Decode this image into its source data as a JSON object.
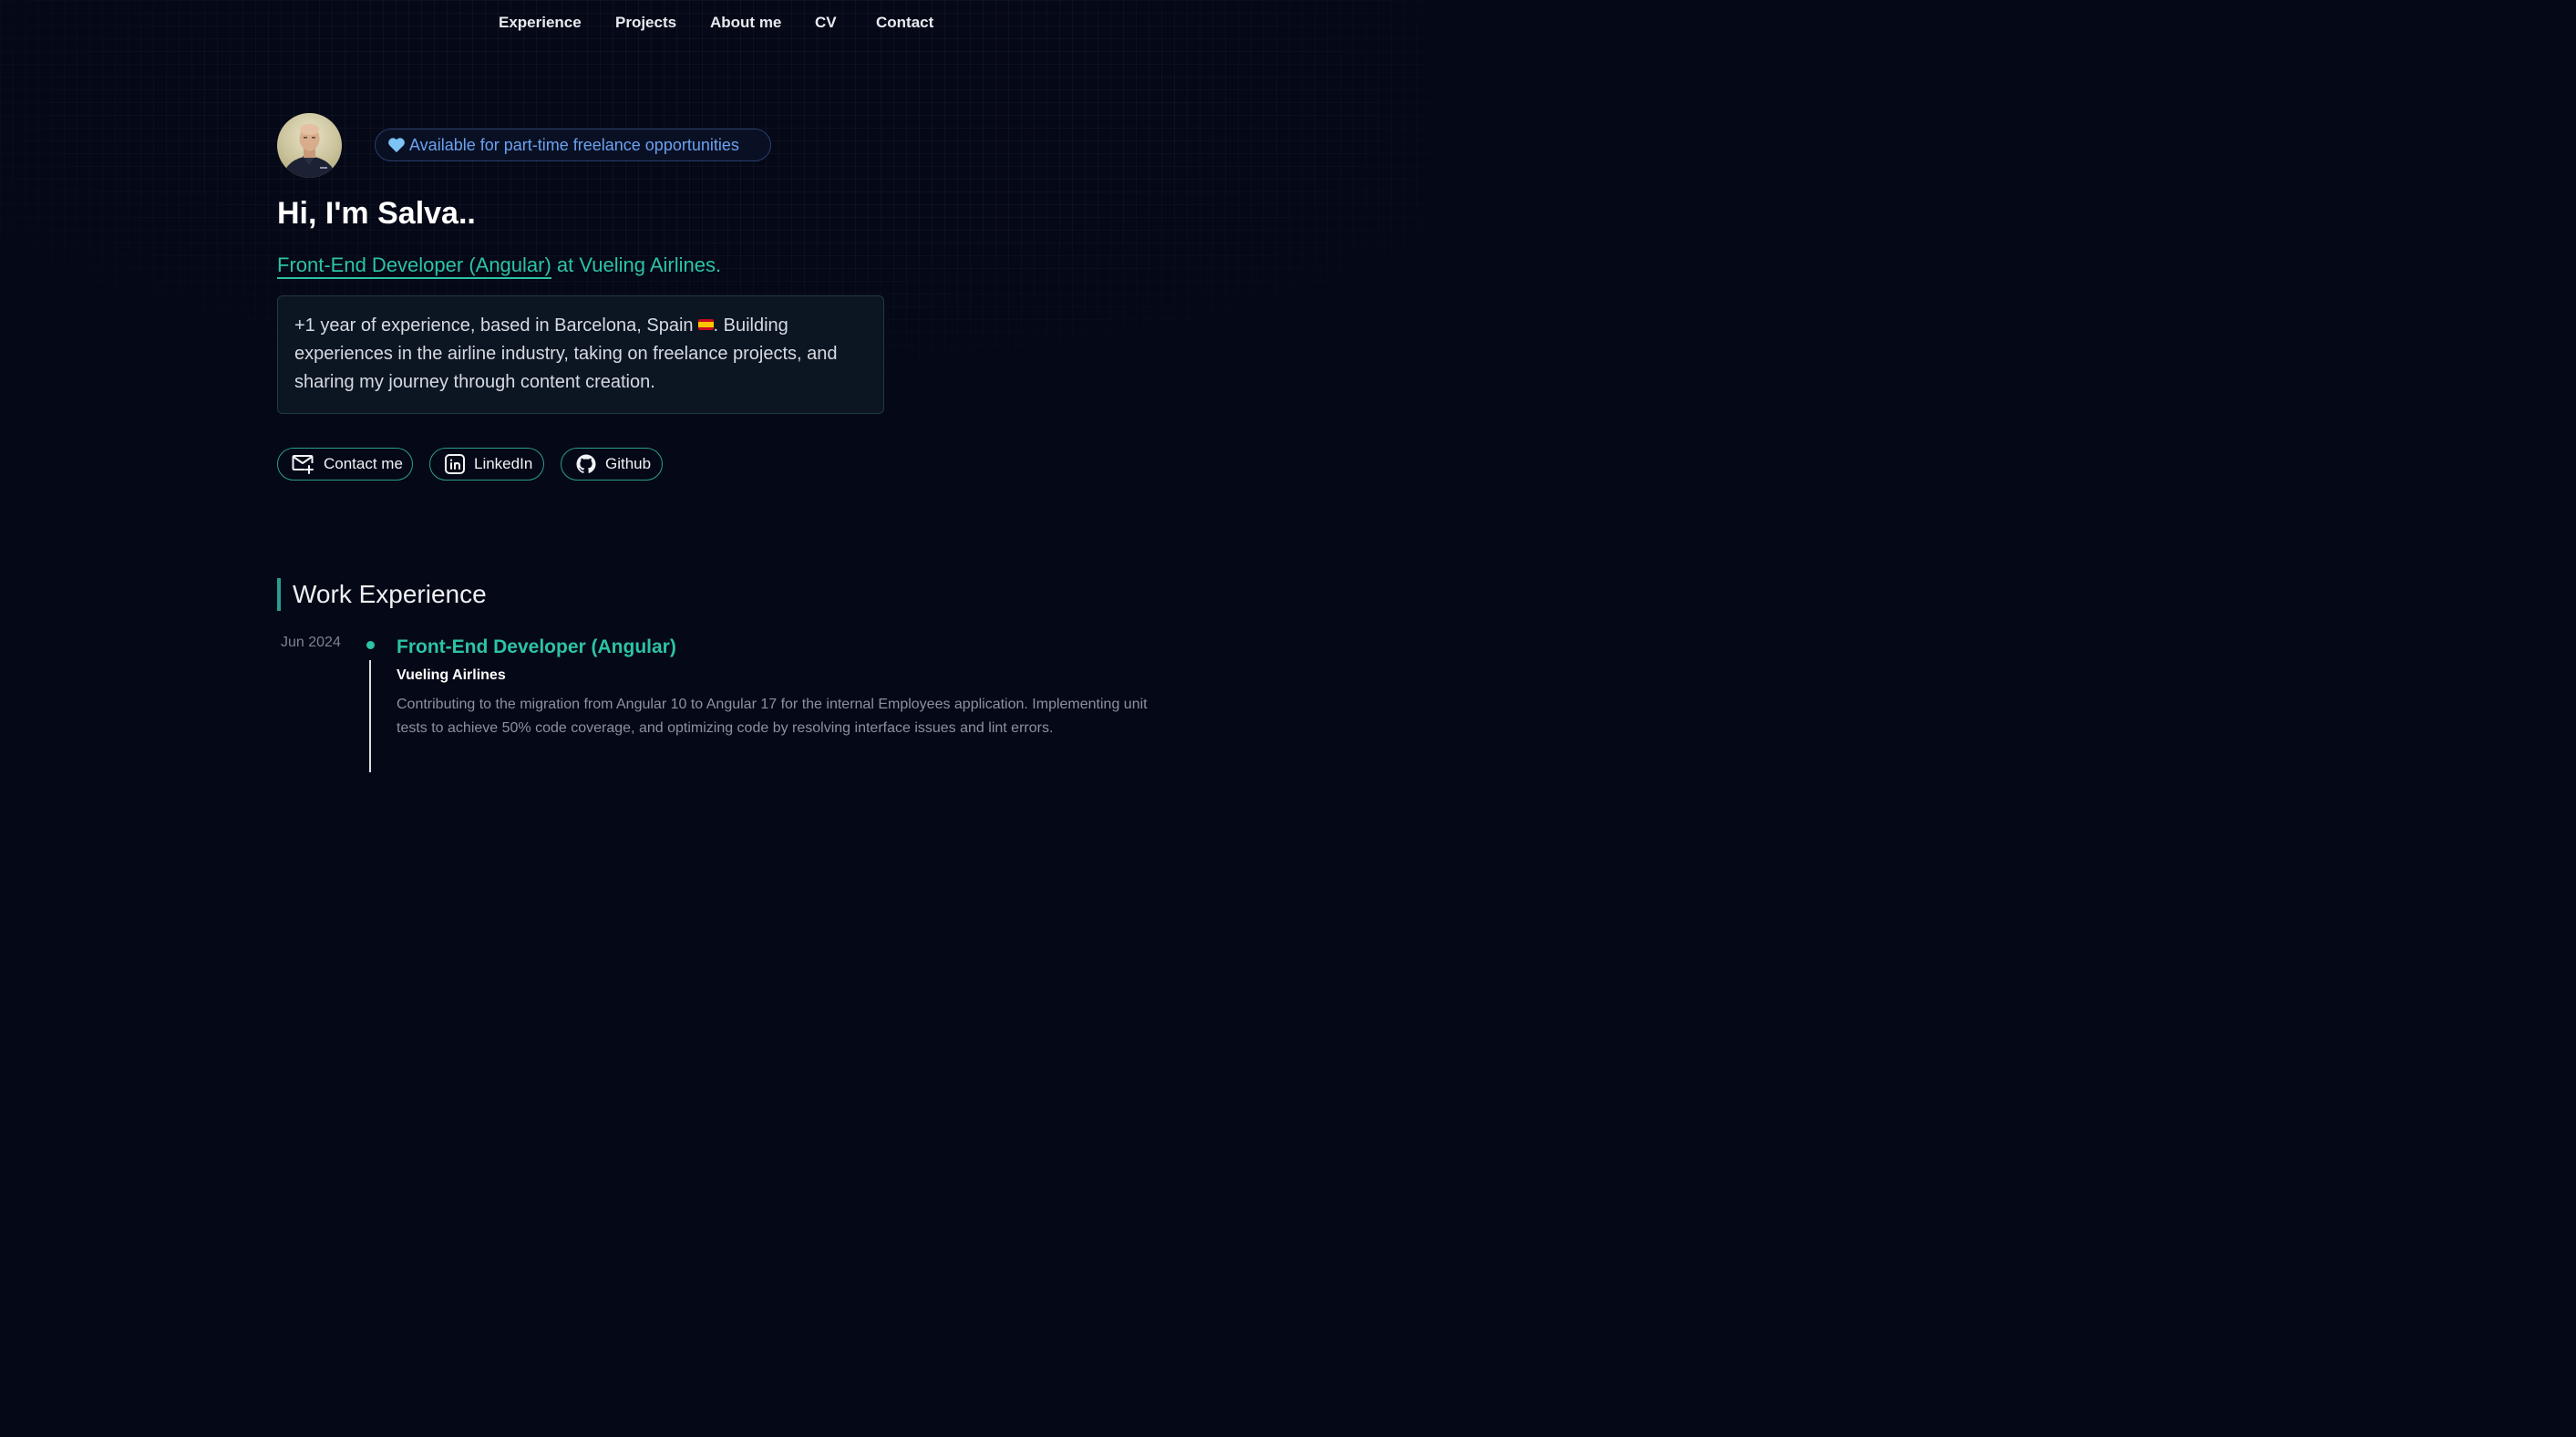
{
  "nav": {
    "items": [
      {
        "label": "Experience"
      },
      {
        "label": "Projects"
      },
      {
        "label": "About me"
      },
      {
        "label": "CV"
      },
      {
        "label": "Contact"
      }
    ]
  },
  "hero": {
    "availability": "Available for part-time freelance opportunities",
    "greeting": "Hi, I'm Salva..",
    "role": "Front-End Developer (Angular)",
    "company_line": " at Vueling Airlines.",
    "bio_before_flag": "+1 year of experience, based in Barcelona, Spain",
    "bio_after_flag": ". Building experiences in the airline industry, taking on freelance projects, and sharing my journey through content creation.",
    "buttons": {
      "contact": "Contact me",
      "linkedin": "LinkedIn",
      "github": "Github"
    }
  },
  "experience": {
    "section_title": "Work Experience",
    "jobs": [
      {
        "date": "Jun 2024",
        "title": "Front-End Developer (Angular)",
        "company": "Vueling Airlines",
        "description": "Contributing to the migration from Angular 10 to Angular 17 for the internal Employees application. Implementing unit tests to achieve 50% code coverage, and optimizing code by resolving interface issues and lint errors."
      }
    ]
  },
  "colors": {
    "background": "#050816",
    "accent": "#2cc3a6",
    "badge_text": "#6ba1ef",
    "button_border": "#2a9d8f"
  },
  "icons": {
    "badge": "heart-icon",
    "contact": "mail-plus-icon",
    "linkedin": "linkedin-icon",
    "github": "github-icon"
  }
}
